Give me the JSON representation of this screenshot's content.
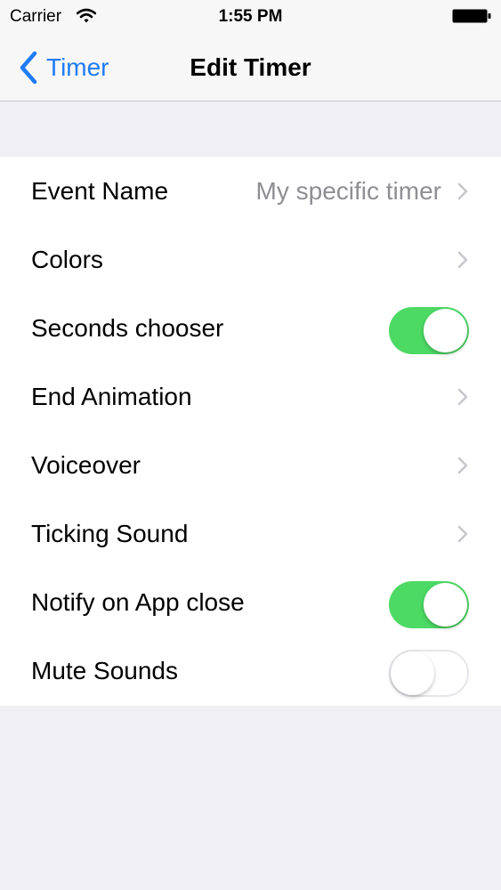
{
  "status_bar": {
    "carrier": "Carrier",
    "time": "1:55 PM"
  },
  "nav": {
    "back_label": "Timer",
    "title": "Edit Timer"
  },
  "settings": {
    "rows": [
      {
        "label": "Event Name",
        "detail": "My specific timer",
        "accessory": "chevron"
      },
      {
        "label": "Colors",
        "accessory": "chevron"
      },
      {
        "label": "Seconds chooser",
        "accessory": "toggle",
        "on": true
      },
      {
        "label": "End Animation",
        "accessory": "chevron"
      },
      {
        "label": "Voiceover",
        "accessory": "chevron"
      },
      {
        "label": "Ticking Sound",
        "accessory": "chevron"
      },
      {
        "label": "Notify on App close",
        "accessory": "toggle",
        "on": true
      },
      {
        "label": "Mute Sounds",
        "accessory": "toggle",
        "on": false
      }
    ]
  },
  "colors": {
    "accent": "#1f7cf5",
    "toggle_on": "#4cd964",
    "detail_text": "#8e8e93",
    "background": "#efeff4"
  }
}
